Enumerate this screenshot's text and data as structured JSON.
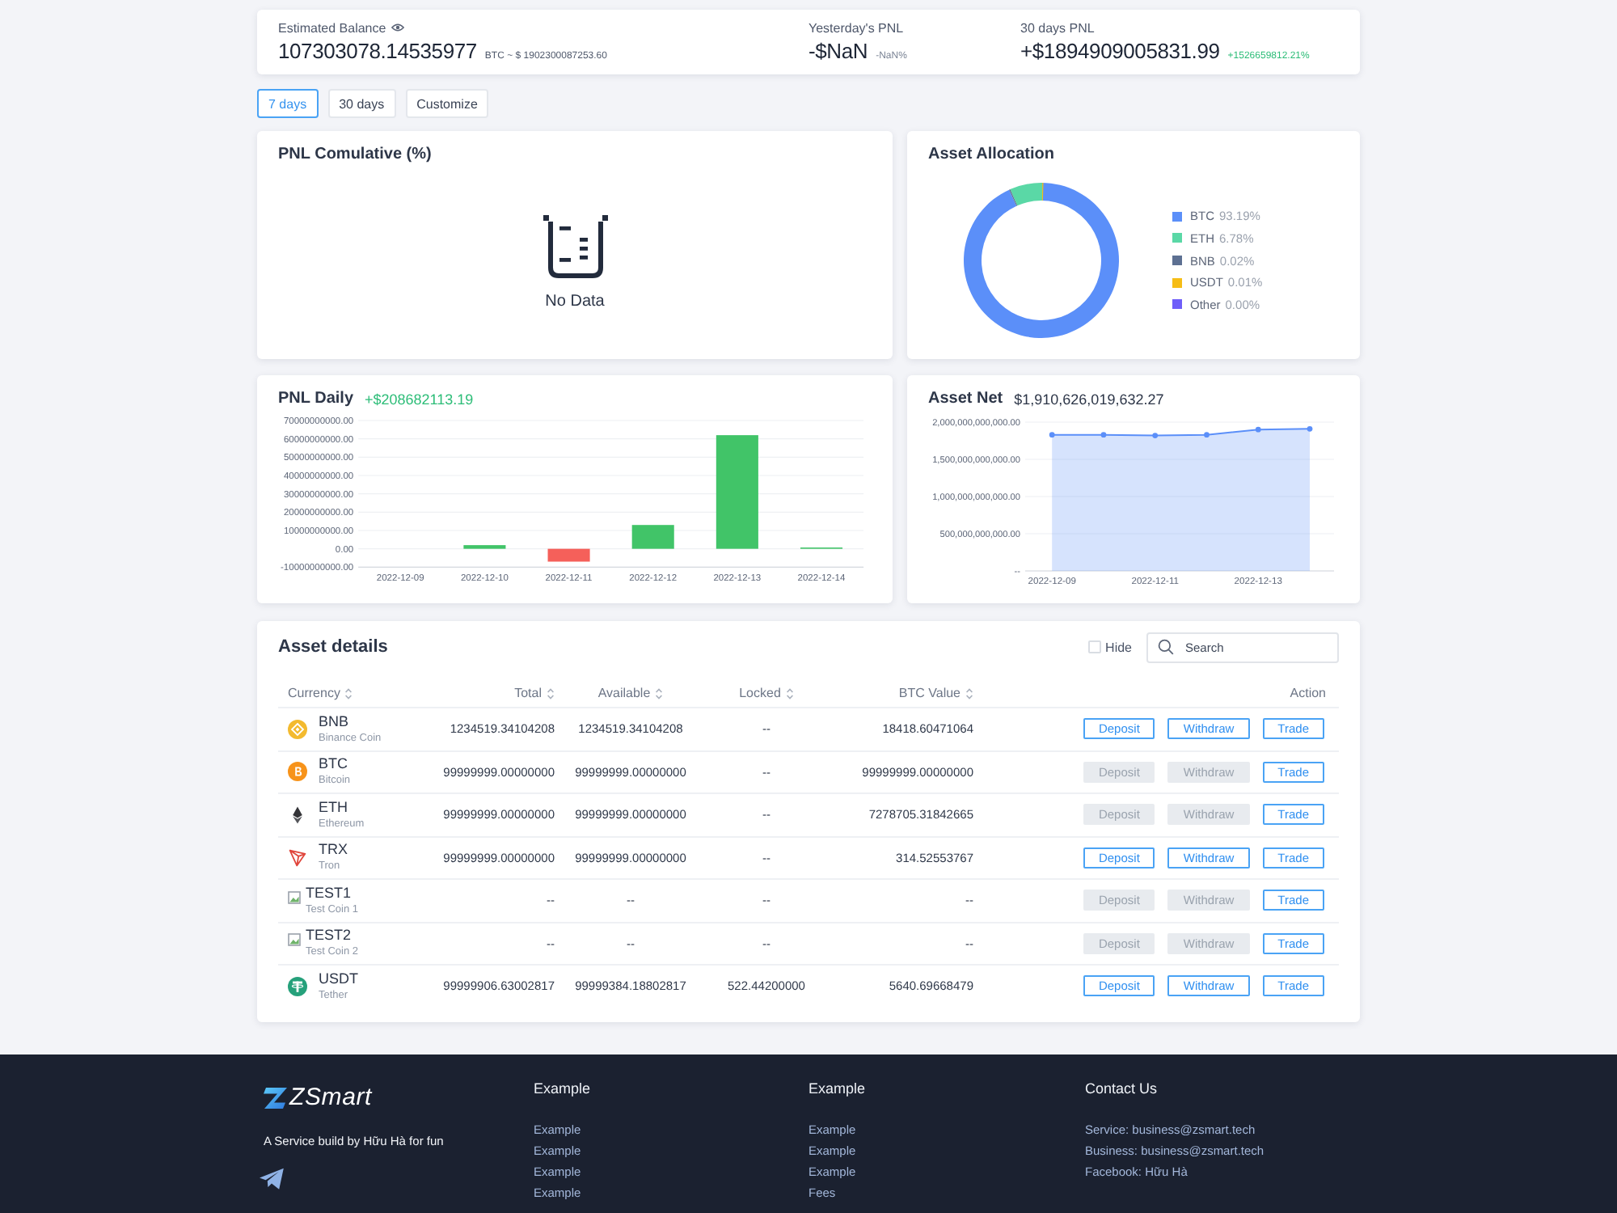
{
  "summary": [
    {
      "kind": "balance",
      "label": "Estimated Balance",
      "value": "107303078.14535977",
      "note": "BTC ~ $ 1902300087253.60",
      "color": "#4f586b"
    },
    {
      "kind": "pnl",
      "label": "Yesterday's PNL",
      "value": "-$NaN",
      "note": "-NaN%",
      "color": "#7c8596"
    },
    {
      "kind": "pnl",
      "label": "30 days PNL",
      "value": "+$1894909005831.99",
      "note": "+1526659812.21%",
      "color": "#2dbd78"
    }
  ],
  "range_tabs": [
    {
      "label": "7 days",
      "selected": true
    },
    {
      "label": "30 days",
      "selected": false
    },
    {
      "label": "Customize",
      "selected": false
    }
  ],
  "pnl_cumulative": {
    "title": "PNL Comulative (%)",
    "empty_text": "No Data"
  },
  "asset_allocation": {
    "title": "Asset Allocation",
    "chart_data": {
      "type": "donut",
      "categories": [
        "BTC",
        "ETH",
        "BNB",
        "USDT",
        "Other"
      ],
      "values": [
        93.19,
        6.78,
        0.02,
        0.01,
        0
      ]
    },
    "legend": [
      {
        "value": "93.19%",
        "color": "#5b8ff9"
      },
      {
        "value": "6.78%",
        "color": "#5ad8a6"
      },
      {
        "value": "0.02%",
        "color": "#5d7092"
      },
      {
        "value": "0.01%",
        "color": "#f6bd16"
      },
      {
        "value": "0.00%",
        "color": "#6f5ef9"
      }
    ]
  },
  "pnl_daily": {
    "title": "PNL Daily",
    "total": "+$208682113.19",
    "chart_data": {
      "type": "bar",
      "categories": [
        "2022-12-09",
        "2022-12-10",
        "2022-12-11",
        "2022-12-12",
        "2022-12-13",
        "2022-12-14"
      ],
      "series": [
        {
          "color": "#41c468",
          "values": [
            null,
            2000000000,
            null,
            13000000000,
            62000000000,
            200000000
          ]
        },
        {
          "color": "#f5605a",
          "values": [
            null,
            null,
            -7000000000,
            null,
            null,
            null
          ]
        }
      ],
      "stacked": true,
      "grid": true,
      "ylim": [
        -10000000000,
        70000000000
      ],
      "yticks": [
        {
          "value": 70000000000,
          "label": "70000000000.00"
        },
        {
          "value": 60000000000,
          "label": "60000000000.00"
        },
        {
          "value": 50000000000,
          "label": "50000000000.00"
        },
        {
          "value": 40000000000,
          "label": "40000000000.00"
        },
        {
          "value": 30000000000,
          "label": "30000000000.00"
        },
        {
          "value": 20000000000,
          "label": "20000000000.00"
        },
        {
          "value": 10000000000,
          "label": "10000000000.00"
        },
        {
          "value": 0,
          "label": "0.00"
        },
        {
          "value": -10000000000,
          "label": "-10000000000.00"
        }
      ]
    }
  },
  "asset_net": {
    "title": "Asset Net",
    "total": "$1,910,626,019,632.27",
    "chart_data": {
      "type": "area",
      "categories": [
        "2022-12-09",
        null,
        "2022-12-11",
        null,
        "2022-12-13",
        null
      ],
      "series": [
        {
          "color": "#5b8ff9",
          "values": [
            1830000000000,
            1830000000000,
            1820000000000,
            1830000000000,
            1900000000000,
            1910000000000
          ]
        }
      ],
      "grid": true,
      "ylim": [
        0,
        2000000000000
      ],
      "yticks": [
        {
          "value": 0,
          "label": "--"
        },
        {
          "value": 500000000000,
          "label": "500,000,000,000.00"
        },
        {
          "value": 1000000000000,
          "label": "1,000,000,000,000.00"
        },
        {
          "value": 1500000000000,
          "label": "1,500,000,000,000.00"
        },
        {
          "value": 2000000000000,
          "label": "2,000,000,000,000.00"
        }
      ]
    }
  },
  "asset_details": {
    "title": "Asset details",
    "hide": {
      "label": "Hide",
      "checked": false
    },
    "search": {
      "placeholder": "Search"
    },
    "columns": [
      {
        "label": "Currency",
        "sortable": true
      },
      {
        "label": "Total",
        "sortable": true
      },
      {
        "label": "Available",
        "sortable": true
      },
      {
        "label": "Locked",
        "sortable": true
      },
      {
        "label": "BTC Value",
        "sortable": true
      },
      {
        "label": "Action",
        "sortable": false
      }
    ],
    "rows": [
      {
        "symbol": "BNB",
        "name": "Binance Coin",
        "total": "1234519.34104208",
        "available": "1234519.34104208",
        "locked": "--",
        "btc_value": "18418.60471064",
        "actions": [
          {
            "label": "Deposit",
            "disabled": false
          },
          {
            "label": "Withdraw",
            "disabled": false
          },
          {
            "label": "Trade",
            "disabled": false
          }
        ]
      },
      {
        "symbol": "BTC",
        "name": "Bitcoin",
        "total": "99999999.00000000",
        "available": "99999999.00000000",
        "locked": "--",
        "btc_value": "99999999.00000000",
        "actions": [
          {
            "label": "Deposit",
            "disabled": true
          },
          {
            "label": "Withdraw",
            "disabled": true
          },
          {
            "label": "Trade",
            "disabled": false
          }
        ]
      },
      {
        "symbol": "ETH",
        "name": "Ethereum",
        "total": "99999999.00000000",
        "available": "99999999.00000000",
        "locked": "--",
        "btc_value": "7278705.31842665",
        "actions": [
          {
            "label": "Deposit",
            "disabled": true
          },
          {
            "label": "Withdraw",
            "disabled": true
          },
          {
            "label": "Trade",
            "disabled": false
          }
        ]
      },
      {
        "symbol": "TRX",
        "name": "Tron",
        "total": "99999999.00000000",
        "available": "99999999.00000000",
        "locked": "--",
        "btc_value": "314.52553767",
        "actions": [
          {
            "label": "Deposit",
            "disabled": false
          },
          {
            "label": "Withdraw",
            "disabled": false
          },
          {
            "label": "Trade",
            "disabled": false
          }
        ]
      },
      {
        "symbol": "TEST1",
        "name": "Test Coin 1",
        "total": "--",
        "available": "--",
        "locked": "--",
        "btc_value": "--",
        "actions": [
          {
            "label": "Deposit",
            "disabled": true
          },
          {
            "label": "Withdraw",
            "disabled": true
          },
          {
            "label": "Trade",
            "disabled": false
          }
        ]
      },
      {
        "symbol": "TEST2",
        "name": "Test Coin 2",
        "total": "--",
        "available": "--",
        "locked": "--",
        "btc_value": "--",
        "actions": [
          {
            "label": "Deposit",
            "disabled": true
          },
          {
            "label": "Withdraw",
            "disabled": true
          },
          {
            "label": "Trade",
            "disabled": false
          }
        ]
      },
      {
        "symbol": "USDT",
        "name": "Tether",
        "total": "99999906.63002817",
        "available": "99999384.18802817",
        "locked": "522.44200000",
        "btc_value": "5640.69668479",
        "actions": [
          {
            "label": "Deposit",
            "disabled": false
          },
          {
            "label": "Withdraw",
            "disabled": false
          },
          {
            "label": "Trade",
            "disabled": false
          }
        ]
      }
    ]
  },
  "footer": {
    "logo_text": "ZSmart",
    "tagline": "A Service build by Hữu Hà for fun",
    "columns": [
      {
        "heading": "Example",
        "links": [
          "Example",
          "Example",
          "Example",
          "Example"
        ]
      },
      {
        "heading": "Example",
        "links": [
          "Example",
          "Example",
          "Example",
          "Fees"
        ]
      },
      {
        "heading": "Contact Us",
        "links": [
          "Service: business@zsmart.tech",
          "Business: business@zsmart.tech",
          "Facebook: Hữu Hà"
        ]
      }
    ]
  }
}
